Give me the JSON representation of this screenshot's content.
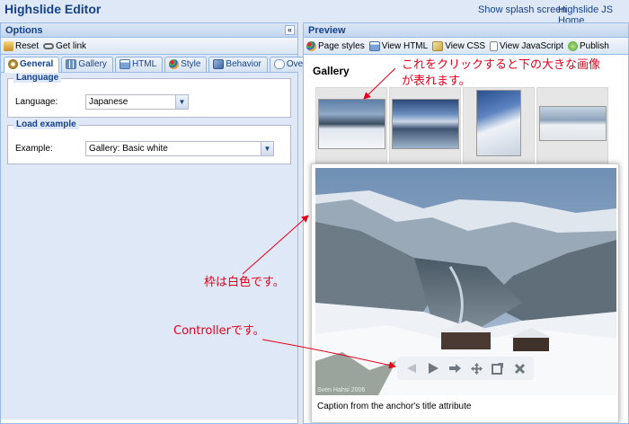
{
  "header": {
    "title": "Highslide Editor",
    "links": [
      "Show splash screen",
      "Highslide JS Home"
    ]
  },
  "options_panel": {
    "title": "Options",
    "collapse_glyph": "«",
    "toolbar": [
      {
        "label": "Reset",
        "icon": "reset-icon"
      },
      {
        "label": "Get link",
        "icon": "link-icon"
      }
    ],
    "tabs": [
      {
        "label": "General",
        "icon": "gear-icon",
        "active": true
      },
      {
        "label": "Gallery",
        "icon": "grid-icon"
      },
      {
        "label": "HTML",
        "icon": "html-icon"
      },
      {
        "label": "Style",
        "icon": "palette-icon"
      },
      {
        "label": "Behavior",
        "icon": "behavior-icon"
      },
      {
        "label": "Overlays",
        "icon": "speech-bubble-icon"
      }
    ],
    "language": {
      "legend": "Language",
      "label": "Language:",
      "value": "Japanese"
    },
    "load_example": {
      "legend": "Load example",
      "label": "Example:",
      "value": "Gallery: Basic white"
    }
  },
  "preview_panel": {
    "title": "Preview",
    "toolbar": [
      {
        "label": "Page styles",
        "icon": "palette-icon"
      },
      {
        "label": "View HTML",
        "icon": "html-icon"
      },
      {
        "label": "View CSS",
        "icon": "css-icon"
      },
      {
        "label": "View JavaScript",
        "icon": "javascript-icon"
      },
      {
        "label": "Publish",
        "icon": "publish-icon"
      }
    ],
    "gallery_title": "Gallery",
    "expander": {
      "caption": "Caption from the anchor's title attribute",
      "credit": "Sven Hahsi 2006",
      "controller_buttons": [
        "previous-icon",
        "play-icon",
        "next-icon",
        "move-icon",
        "full-size-icon",
        "close-icon"
      ]
    }
  },
  "annotations": {
    "thumbnail_note_line1": "これをクリックすると下の大きな画像",
    "thumbnail_note_line2": "が表れます。",
    "border_note": "枠は白色です。",
    "controller_note": "Controllerです。"
  },
  "colors": {
    "panel_border": "#99bbe8",
    "header_text": "#15428b",
    "annotation": "#e3001b"
  }
}
